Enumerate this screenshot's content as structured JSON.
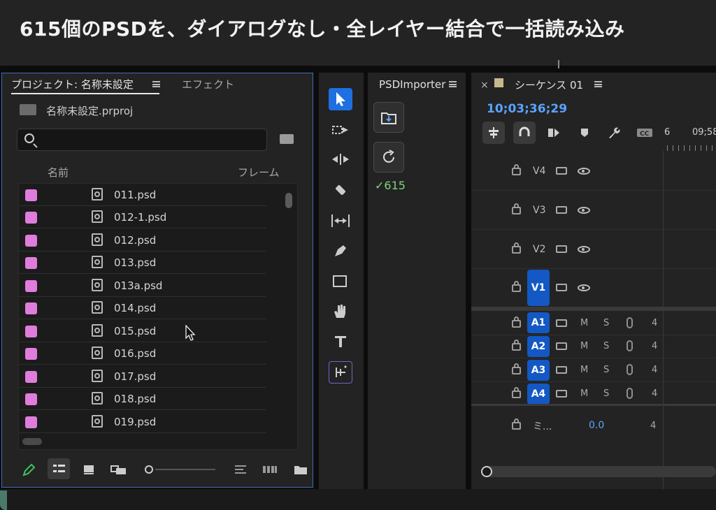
{
  "caption": "615個のPSDを、ダイアログなし・全レイヤー結合で一括読み込み",
  "project_panel": {
    "tab_project": "プロジェクト: 名称未設定",
    "tab_effects": "エフェクト",
    "project_file": "名称未設定.prproj",
    "search_placeholder": "",
    "col_name": "名前",
    "col_frame": "フレーム",
    "label_color": "#e07ddc",
    "files": [
      "011.psd",
      "012-1.psd",
      "012.psd",
      "013.psd",
      "013a.psd",
      "014.psd",
      "015.psd",
      "016.psd",
      "017.psd",
      "018.psd",
      "019.psd"
    ]
  },
  "tools": [
    "selection-tool",
    "track-select-tool",
    "ripple-edit-tool",
    "razor-tool",
    "slip-tool",
    "pen-tool",
    "rectangle-tool",
    "hand-tool",
    "type-tool",
    "generative-tool"
  ],
  "psd_importer": {
    "title": "PSDImporter",
    "imported": "✓615"
  },
  "timeline": {
    "close": "×",
    "title": "シーケンス 01",
    "timecode": "10;03;36;29",
    "ruler_left": "6",
    "ruler_right": "09;58",
    "video_tracks": [
      "V4",
      "V3",
      "V2",
      "V1"
    ],
    "audio_tracks": [
      "A1",
      "A2",
      "A3",
      "A4"
    ],
    "mute": "M",
    "solo": "S",
    "audio_value": "4",
    "master_label": "ミ...",
    "master_value": "0.0",
    "master_right": "4"
  }
}
